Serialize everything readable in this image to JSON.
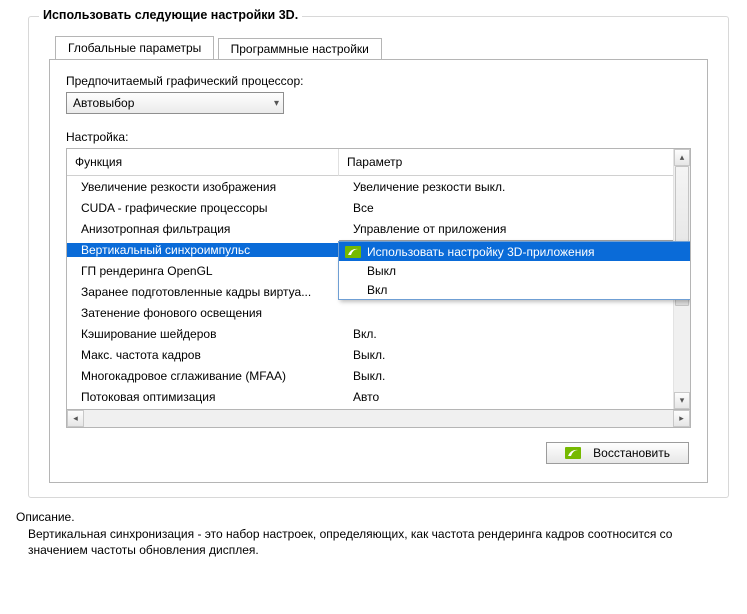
{
  "group_title": "Использовать следующие настройки 3D.",
  "tabs": {
    "global": "Глобальные параметры",
    "program": "Программные настройки"
  },
  "pref_gpu_label": "Предпочитаемый графический процессор:",
  "pref_gpu_value": "Автовыбор",
  "setting_label": "Настройка:",
  "headers": {
    "func": "Функция",
    "param": "Параметр"
  },
  "rows": [
    {
      "func": "Увеличение резкости изображения",
      "param": "Увеличение резкости выкл."
    },
    {
      "func": "CUDA - графические процессоры",
      "param": "Все"
    },
    {
      "func": "Анизотропная фильтрация",
      "param": "Управление от приложения"
    },
    {
      "func": "Вертикальный синхроимпульс",
      "param": "Использовать настройку 3D-приложения",
      "selected": true
    },
    {
      "func": "ГП рендеринга OpenGL",
      "param": ""
    },
    {
      "func": "Заранее подготовленные кадры виртуа...",
      "param": ""
    },
    {
      "func": "Затенение фонового освещения",
      "param": ""
    },
    {
      "func": "Кэширование шейдеров",
      "param": "Вкл."
    },
    {
      "func": "Макс. частота кадров",
      "param": "Выкл."
    },
    {
      "func": "Многокадровое сглаживание (MFAA)",
      "param": "Выкл."
    },
    {
      "func": "Потоковая оптимизация",
      "param": "Авто"
    }
  ],
  "dropdown": {
    "options": [
      "Использовать настройку 3D-приложения",
      "Выкл",
      "Вкл"
    ],
    "selected_index": 0
  },
  "restore_label": "Восстановить",
  "description": {
    "title": "Описание.",
    "body": "Вертикальная синхронизация - это набор настроек, определяющих, как частота рендеринга кадров соотносится со значением частоты обновления дисплея."
  }
}
